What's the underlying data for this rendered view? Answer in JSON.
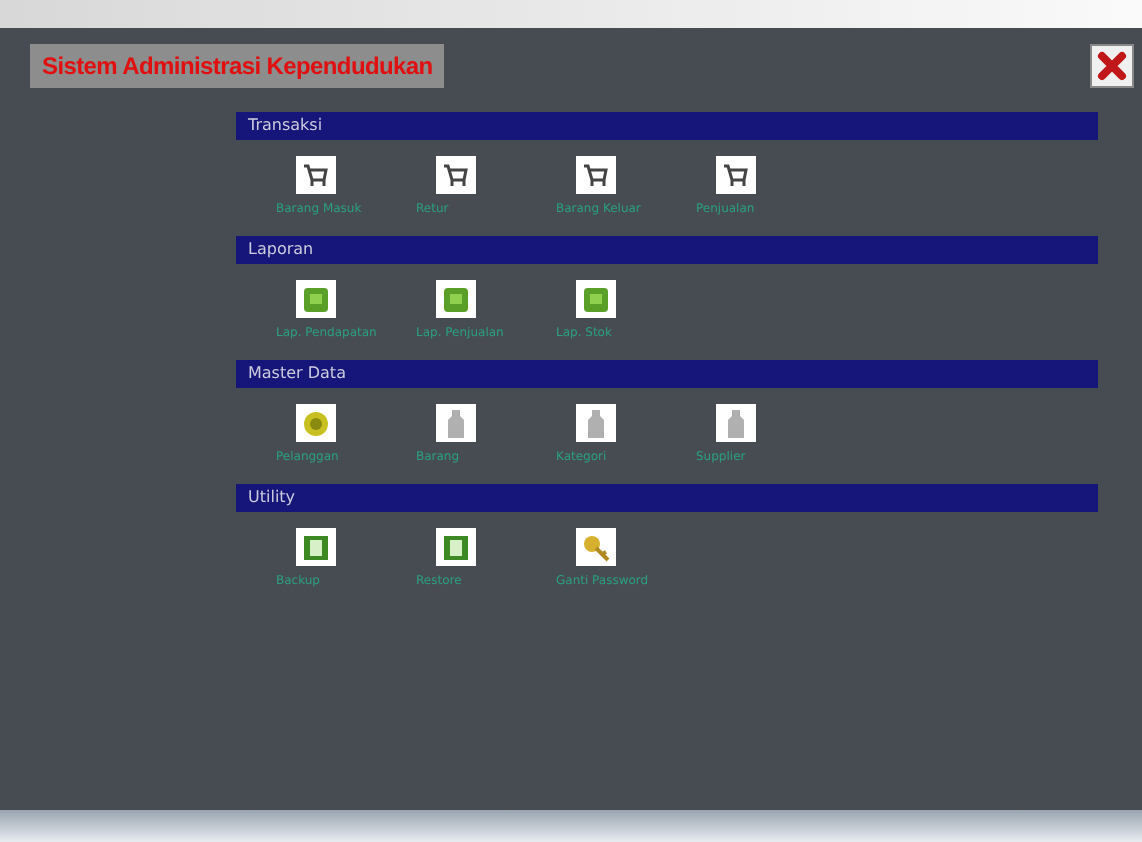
{
  "window": {
    "title": "Sistem Administrasi Kependudukan"
  },
  "sections": [
    {
      "title": "Transaksi",
      "items": [
        {
          "label": "Barang Masuk",
          "kind": "cart"
        },
        {
          "label": "Retur",
          "kind": "cart"
        },
        {
          "label": "Barang Keluar",
          "kind": "cart"
        },
        {
          "label": "Penjualan",
          "kind": "cart"
        }
      ]
    },
    {
      "title": "Laporan",
      "items": [
        {
          "label": "Lap. Pendapatan",
          "kind": "report"
        },
        {
          "label": "Lap. Penjualan",
          "kind": "report"
        },
        {
          "label": "Lap. Stok",
          "kind": "report"
        }
      ]
    },
    {
      "title": "Master Data",
      "items": [
        {
          "label": "Pelanggan",
          "kind": "user"
        },
        {
          "label": "Barang",
          "kind": "bottle"
        },
        {
          "label": "Kategori",
          "kind": "bottle"
        },
        {
          "label": "Supplier",
          "kind": "bottle"
        }
      ]
    },
    {
      "title": "Utility",
      "items": [
        {
          "label": "Backup",
          "kind": "door"
        },
        {
          "label": "Restore",
          "kind": "door"
        },
        {
          "label": "Ganti Password",
          "kind": "key"
        }
      ]
    }
  ]
}
